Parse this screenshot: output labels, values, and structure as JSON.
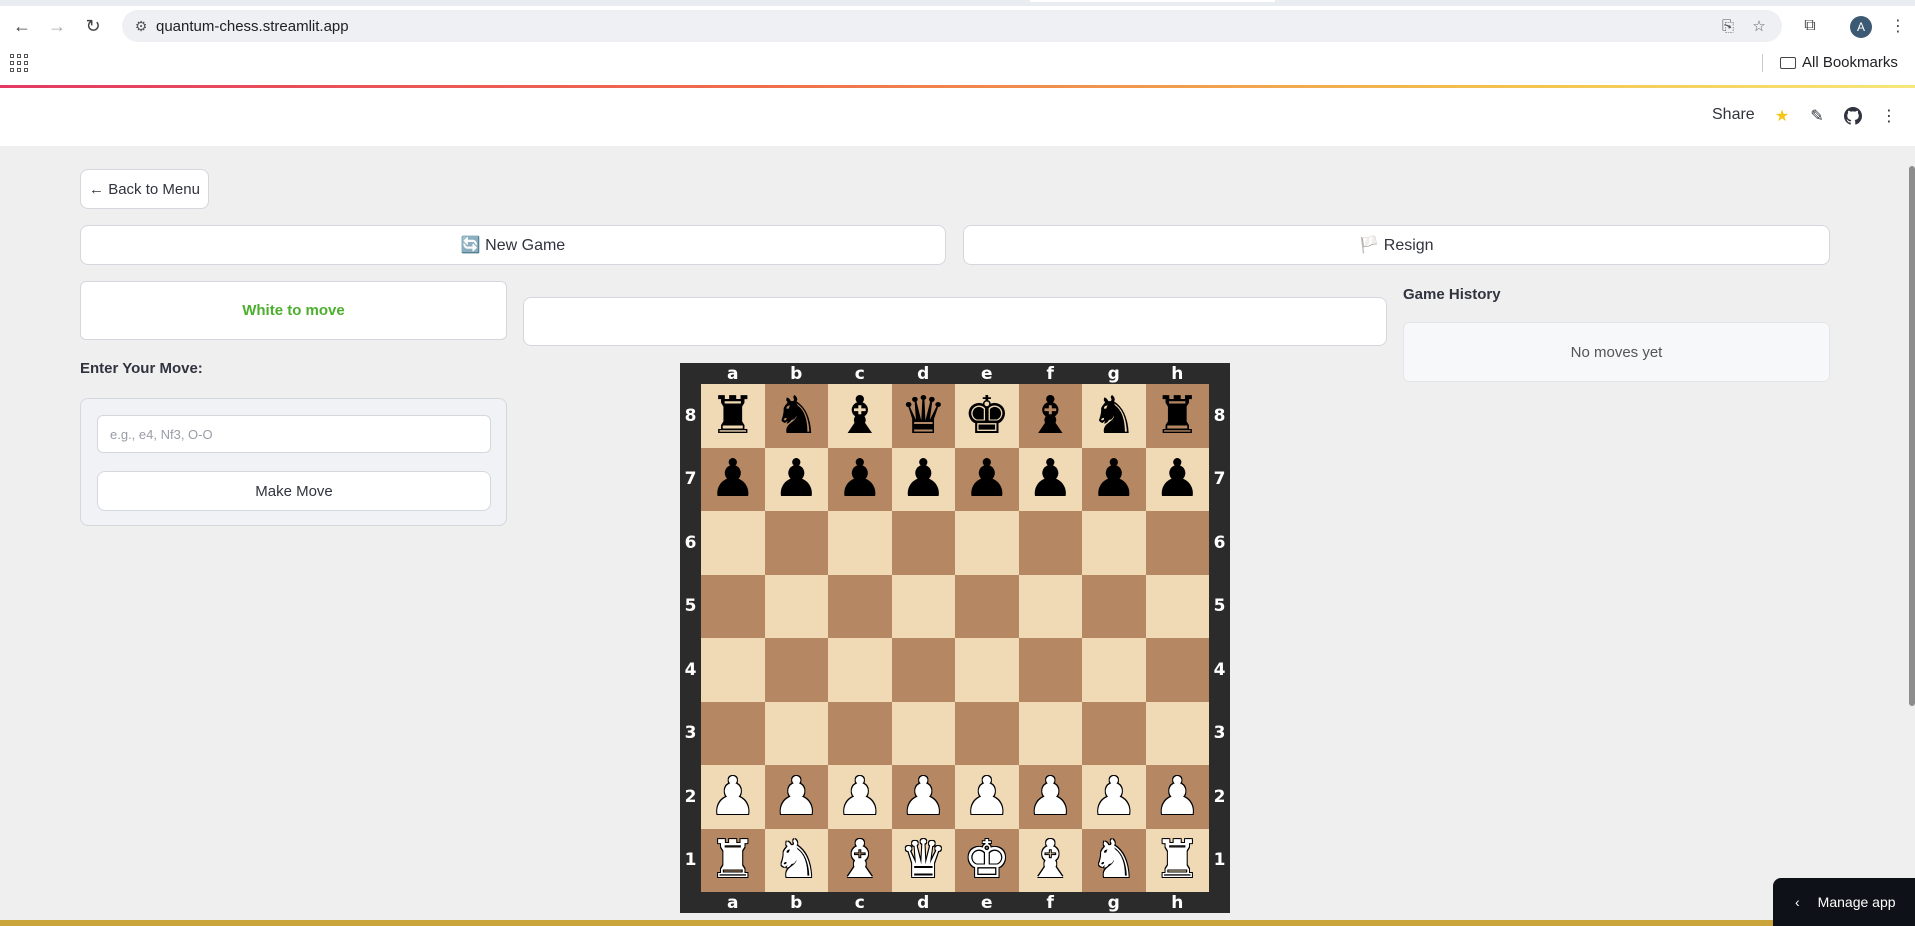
{
  "browser": {
    "url": "quantum-chess.streamlit.app",
    "bookmarks_label": "All Bookmarks",
    "avatar_letter": "A"
  },
  "header": {
    "share_label": "Share"
  },
  "app": {
    "back_label": "← Back to Menu",
    "new_game_label": "🔄 New Game",
    "resign_label": "🏳️ Resign",
    "status": "White to move",
    "status_color": "#4caf2c",
    "enter_move_label": "Enter Your Move:",
    "move_placeholder": "e.g., e4, Nf3, O-O",
    "make_move_label": "Make Move",
    "history_title": "Game History",
    "history_empty": "No moves yet",
    "message_text": ""
  },
  "board": {
    "files": [
      "a",
      "b",
      "c",
      "d",
      "e",
      "f",
      "g",
      "h"
    ],
    "ranks": [
      "8",
      "7",
      "6",
      "5",
      "4",
      "3",
      "2",
      "1"
    ],
    "light_color": "#f0d9b5",
    "dark_color": "#b58863",
    "position": [
      [
        "r",
        "n",
        "b",
        "q",
        "k",
        "b",
        "n",
        "r"
      ],
      [
        "p",
        "p",
        "p",
        "p",
        "p",
        "p",
        "p",
        "p"
      ],
      [
        "",
        "",
        "",
        "",
        "",
        "",
        "",
        ""
      ],
      [
        "",
        "",
        "",
        "",
        "",
        "",
        "",
        ""
      ],
      [
        "",
        "",
        "",
        "",
        "",
        "",
        "",
        ""
      ],
      [
        "",
        "",
        "",
        "",
        "",
        "",
        "",
        ""
      ],
      [
        "P",
        "P",
        "P",
        "P",
        "P",
        "P",
        "P",
        "P"
      ],
      [
        "R",
        "N",
        "B",
        "Q",
        "K",
        "B",
        "N",
        "R"
      ]
    ]
  },
  "manage_app_label": "Manage app"
}
